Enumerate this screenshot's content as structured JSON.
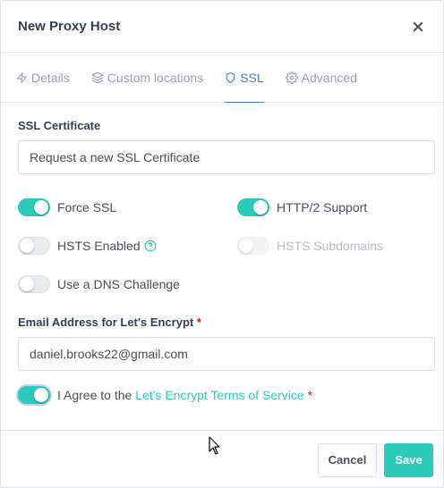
{
  "modal": {
    "title": "New Proxy Host"
  },
  "tabs": [
    {
      "label": "Details",
      "icon": "bolt-icon",
      "active": false
    },
    {
      "label": "Custom locations",
      "icon": "layers-icon",
      "active": false
    },
    {
      "label": "SSL",
      "icon": "shield-icon",
      "active": true
    },
    {
      "label": "Advanced",
      "icon": "gear-icon",
      "active": false
    }
  ],
  "ssl": {
    "certificate_label": "SSL Certificate",
    "certificate_value": "Request a new SSL Certificate",
    "force_ssl": {
      "label": "Force SSL",
      "checked": true
    },
    "http2": {
      "label": "HTTP/2 Support",
      "checked": true
    },
    "hsts": {
      "label": "HSTS Enabled",
      "checked": false
    },
    "hsts_sub": {
      "label": "HSTS Subdomains",
      "checked": false,
      "disabled": true
    },
    "dns": {
      "label": "Use a DNS Challenge",
      "checked": false
    },
    "email_label": "Email Address for Let's Encrypt",
    "required_mark": "*",
    "email_value": "daniel.brooks22@gmail.com",
    "agree": {
      "prefix": "I Agree to the",
      "link": "Let's Encrypt Terms of Service",
      "checked": true
    }
  },
  "footer": {
    "cancel": "Cancel",
    "save": "Save"
  },
  "colors": {
    "accent": "#2bcbba",
    "tab_active": "#467fcf",
    "required": "#cd201f"
  }
}
